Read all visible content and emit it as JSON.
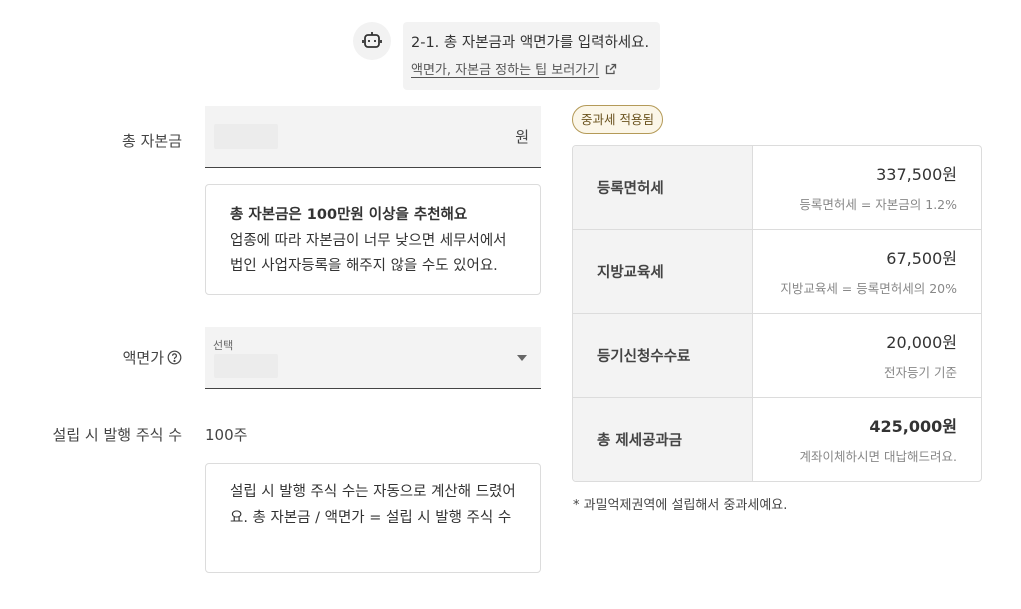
{
  "chat": {
    "message": "2-1. 총 자본금과 액면가를 입력하세요.",
    "link_text": "액면가, 자본금 정하는 팁 보러가기"
  },
  "capital": {
    "label": "총 자본금",
    "unit": "원",
    "tip_title": "총 자본금은 100만원 이상을 추천해요",
    "tip_body": "업종에 따라 자본금이 너무 낮으면 세무서에서 법인 사업자등록을 해주지 않을 수도 있어요."
  },
  "par_value": {
    "label": "액면가",
    "select_caption": "선택"
  },
  "shares": {
    "label": "설립 시 발행 주식 수",
    "value": "100주",
    "info": "설립 시 발행 주식 수는 자동으로 계산해 드렸어요. 총 자본금 / 액면가 = 설립 시 발행 주식 수"
  },
  "badge": "중과세 적용됨",
  "fees": [
    {
      "name": "등록면허세",
      "amount": "337,500원",
      "note": "등록면허세 = 자본금의 1.2%"
    },
    {
      "name": "지방교육세",
      "amount": "67,500원",
      "note": "지방교육세 = 등록면허세의 20%"
    },
    {
      "name": "등기신청수수료",
      "amount": "20,000원",
      "note": "전자등기 기준"
    },
    {
      "name": "총 제세공과금",
      "amount": "425,000원",
      "note": "계좌이체하시면 대납해드려요."
    }
  ],
  "footnote": "* 과밀억제권역에 설립해서 중과세예요.",
  "icons": {
    "bot": "robot-icon",
    "external_link": "external-link-icon",
    "help": "question-circle-icon",
    "caret": "chevron-down-icon"
  }
}
